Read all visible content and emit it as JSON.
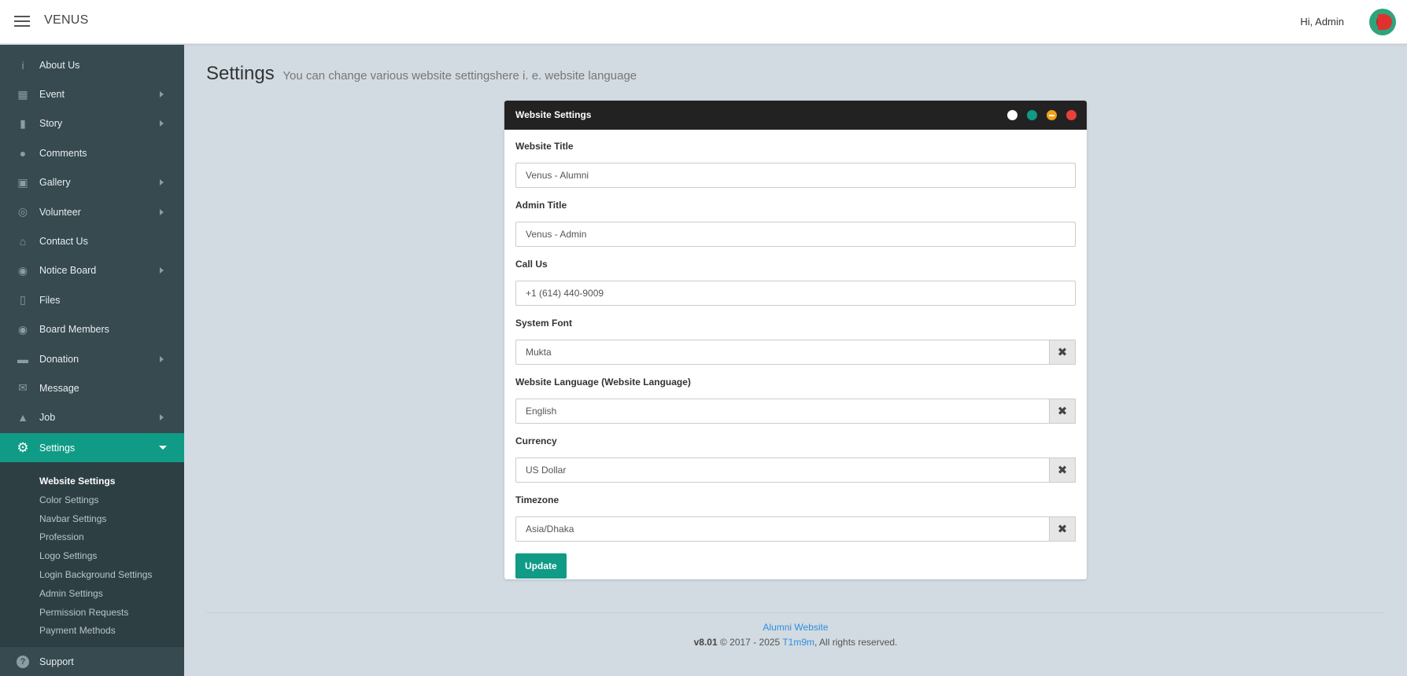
{
  "topbar": {
    "brand": "VENUS",
    "greeting": "Hi, Admin"
  },
  "sidebar": {
    "items": [
      {
        "label": "About Us",
        "icon": "info-icon",
        "has_children": false
      },
      {
        "label": "Event",
        "icon": "calendar-icon",
        "has_children": true
      },
      {
        "label": "Story",
        "icon": "book-icon",
        "has_children": true
      },
      {
        "label": "Comments",
        "icon": "comments-icon",
        "has_children": false
      },
      {
        "label": "Gallery",
        "icon": "image-icon",
        "has_children": true
      },
      {
        "label": "Volunteer",
        "icon": "lifebuoy-icon",
        "has_children": true
      },
      {
        "label": "Contact Us",
        "icon": "bank-icon",
        "has_children": false
      },
      {
        "label": "Notice Board",
        "icon": "broadcast-icon",
        "has_children": true
      },
      {
        "label": "Files",
        "icon": "file-icon",
        "has_children": false
      },
      {
        "label": "Board Members",
        "icon": "user-circle-icon",
        "has_children": false
      },
      {
        "label": "Donation",
        "icon": "credit-card-icon",
        "has_children": true
      },
      {
        "label": "Message",
        "icon": "envelope-icon",
        "has_children": false
      },
      {
        "label": "Job",
        "icon": "lock-icon",
        "has_children": true
      }
    ],
    "active": {
      "label": "Settings",
      "icon": "gear-icon"
    },
    "submenu": [
      "Website Settings",
      "Color Settings",
      "Navbar Settings",
      "Profession",
      "Logo Settings",
      "Login Background Settings",
      "Admin Settings",
      "Permission Requests",
      "Payment Methods"
    ],
    "support": {
      "label": "Support",
      "icon": "question-icon"
    }
  },
  "header": {
    "title": "Settings",
    "subtitle": "You can change various website settingshere i. e. website language"
  },
  "panel": {
    "title": "Website Settings",
    "controls": [
      "expand-icon",
      "refresh-icon",
      "minimize-icon",
      "close-icon"
    ],
    "control_colors": [
      "#ffffff",
      "#0f9b86",
      "#f0a21b",
      "#e8413a"
    ],
    "fields": {
      "website_title": {
        "label": "Website Title",
        "value": "Venus - Alumni"
      },
      "admin_title": {
        "label": "Admin Title",
        "value": "Venus - Admin"
      },
      "call_us": {
        "label": "Call Us",
        "value": "+1 (614) 440-9009"
      },
      "system_font": {
        "label": "System Font",
        "value": "Mukta"
      },
      "website_language": {
        "label": "Website Language (Website Language)",
        "value": "English"
      },
      "currency": {
        "label": "Currency",
        "value": "US Dollar"
      },
      "timezone": {
        "label": "Timezone",
        "value": "Asia/Dhaka"
      }
    },
    "clear_symbol": "✖",
    "update_label": "Update"
  },
  "footer": {
    "site_link": "Alumni Website",
    "version": "v8.01",
    "copyright": "© 2017 - 2025",
    "author": "T1m9m",
    "rights": ", All rights reserved."
  },
  "colors": {
    "accent": "#0f9b86",
    "sidebar_bg": "#364a4f",
    "page_bg": "#d2dbe1",
    "link": "#2f8ee0"
  }
}
